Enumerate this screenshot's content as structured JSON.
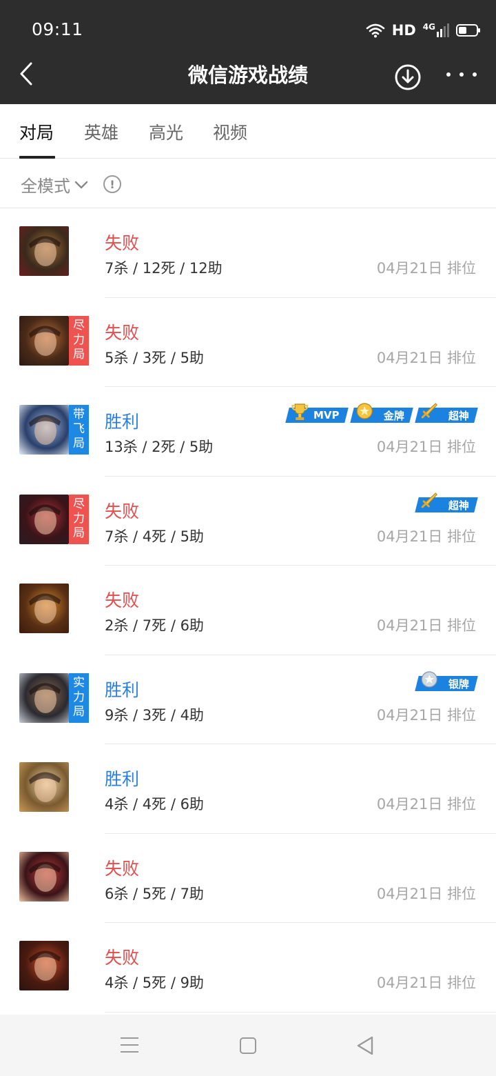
{
  "status": {
    "time": "09:11",
    "network": "HD",
    "signal": "4G",
    "battery_level": 0.45
  },
  "header": {
    "title": "微信游戏战绩"
  },
  "tabs": [
    {
      "label": "对局",
      "active": true
    },
    {
      "label": "英雄",
      "active": false
    },
    {
      "label": "高光",
      "active": false
    },
    {
      "label": "视频",
      "active": false
    }
  ],
  "filter": {
    "mode_label": "全模式",
    "info_symbol": "!"
  },
  "matches": [
    {
      "result": "失败",
      "outcome": "lose",
      "kda": "7杀 / 12死 / 12助",
      "date": "04月21日",
      "type": "排位",
      "tag": null,
      "badges": []
    },
    {
      "result": "失败",
      "outcome": "lose",
      "kda": "5杀 / 3死 / 5助",
      "date": "04月21日",
      "type": "排位",
      "tag": {
        "text": "尽力局",
        "color": "#ef5350"
      },
      "badges": []
    },
    {
      "result": "胜利",
      "outcome": "win",
      "kda": "13杀 / 2死 / 5助",
      "date": "04月21日",
      "type": "排位",
      "tag": {
        "text": "带飞局",
        "color": "#1e88e5"
      },
      "badges": [
        {
          "label": "MVP",
          "icon": "trophy-icon"
        },
        {
          "label": "金牌",
          "icon": "gold-medal-icon"
        },
        {
          "label": "超神",
          "icon": "sword-icon"
        }
      ]
    },
    {
      "result": "失败",
      "outcome": "lose",
      "kda": "7杀 / 4死 / 5助",
      "date": "04月21日",
      "type": "排位",
      "tag": {
        "text": "尽力局",
        "color": "#ef5350"
      },
      "badges": [
        {
          "label": "超神",
          "icon": "sword-icon"
        }
      ]
    },
    {
      "result": "失败",
      "outcome": "lose",
      "kda": "2杀 / 7死 / 6助",
      "date": "04月21日",
      "type": "排位",
      "tag": null,
      "badges": []
    },
    {
      "result": "胜利",
      "outcome": "win",
      "kda": "9杀 / 3死 / 4助",
      "date": "04月21日",
      "type": "排位",
      "tag": {
        "text": "实力局",
        "color": "#1e88e5"
      },
      "badges": [
        {
          "label": "银牌",
          "icon": "silver-medal-icon"
        }
      ]
    },
    {
      "result": "胜利",
      "outcome": "win",
      "kda": "4杀 / 4死 / 6助",
      "date": "04月21日",
      "type": "排位",
      "tag": null,
      "badges": []
    },
    {
      "result": "失败",
      "outcome": "lose",
      "kda": "6杀 / 5死 / 7助",
      "date": "04月21日",
      "type": "排位",
      "tag": null,
      "badges": []
    },
    {
      "result": "失败",
      "outcome": "lose",
      "kda": "4杀 / 5死 / 9助",
      "date": "04月21日",
      "type": "排位",
      "tag": null,
      "badges": []
    }
  ],
  "colors": {
    "header_bg": "#2d2d2d",
    "lose": "#e84c4c",
    "win": "#2b7fd8",
    "badge": "#1b82e0"
  }
}
